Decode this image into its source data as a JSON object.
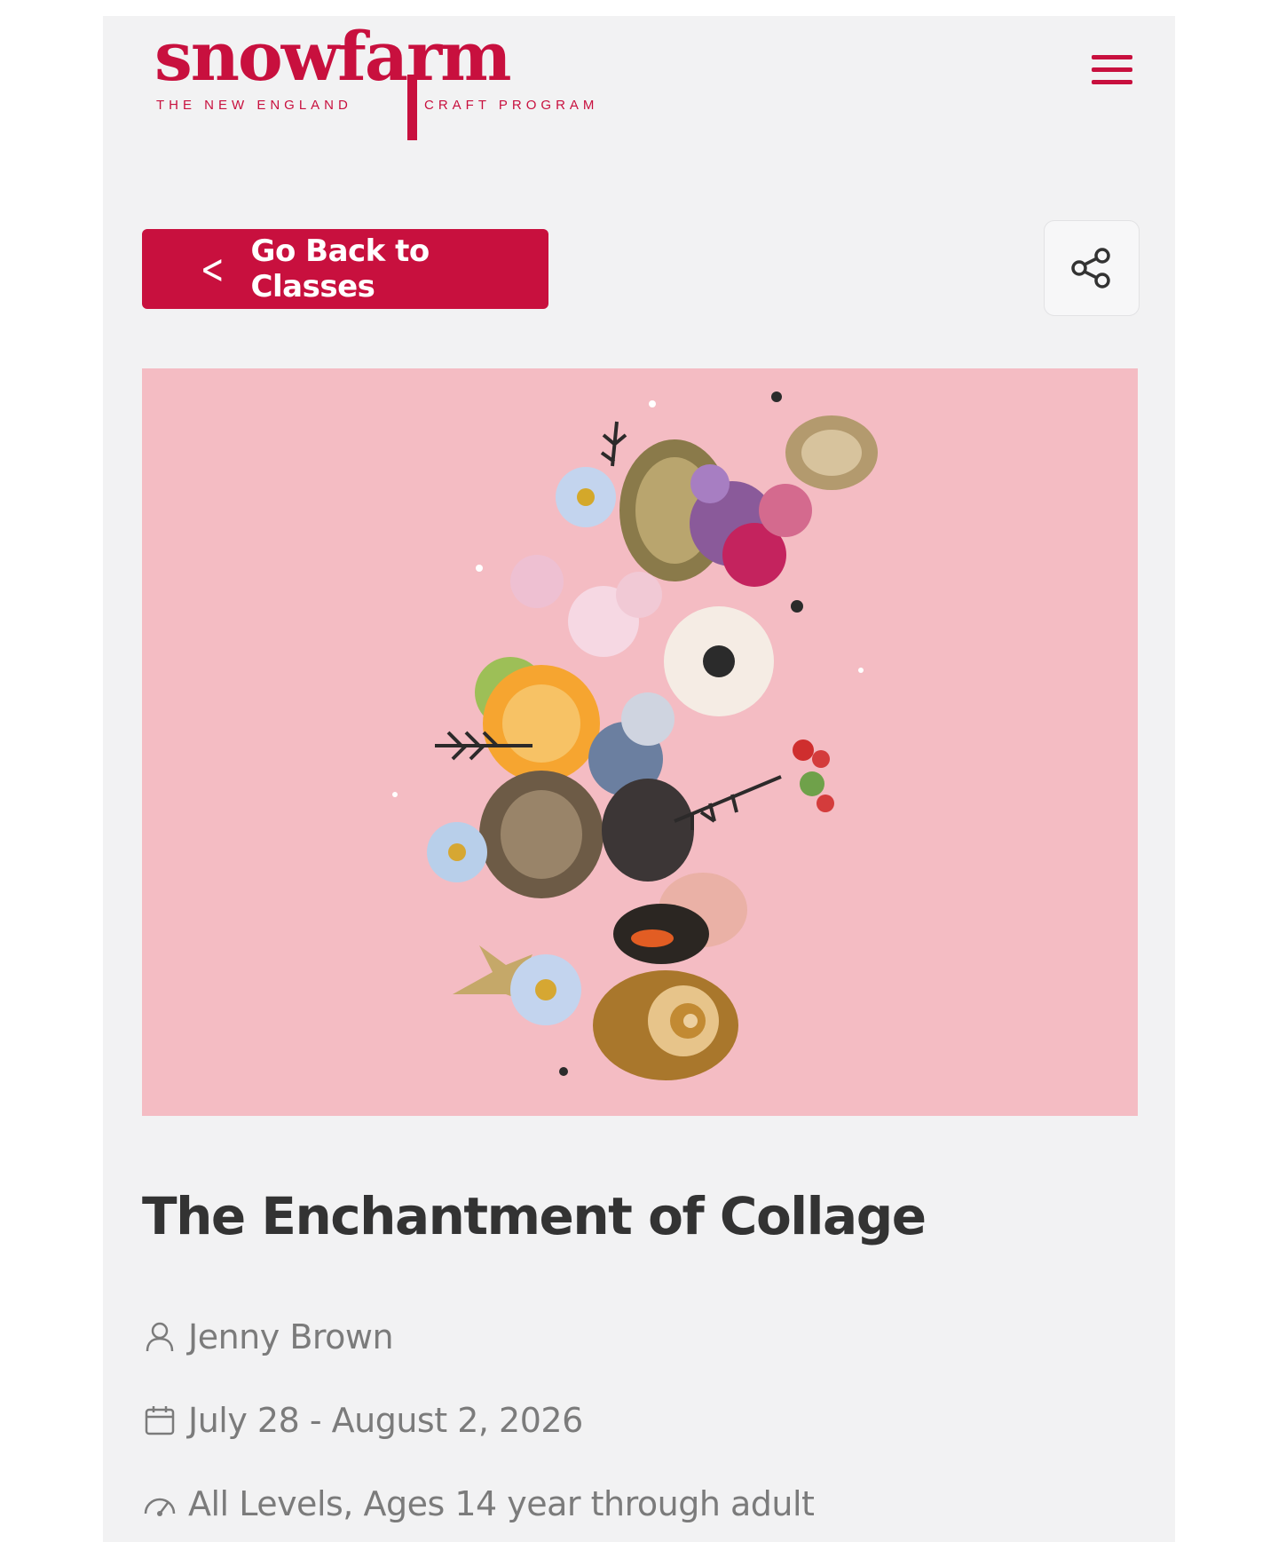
{
  "brand": {
    "name": "snowfarm",
    "tagline_left": "THE NEW ENGLAND",
    "tagline_right": "CRAFT PROGRAM",
    "color": "#c8103e"
  },
  "header": {
    "menu_icon": "hamburger-icon"
  },
  "toolbar": {
    "back_label": "Go Back to Classes",
    "back_icon": "chevron-left-icon",
    "share_icon": "share-icon"
  },
  "hero": {
    "background_color": "#f4bcc3"
  },
  "class": {
    "title": "The Enchantment of Collage",
    "instructor": "Jenny Brown",
    "dates": "July 28 - August 2, 2026",
    "level": "All Levels, Ages 14 year through adult"
  },
  "icons": {
    "instructor": "person-icon",
    "dates": "calendar-icon",
    "level": "gauge-icon"
  }
}
